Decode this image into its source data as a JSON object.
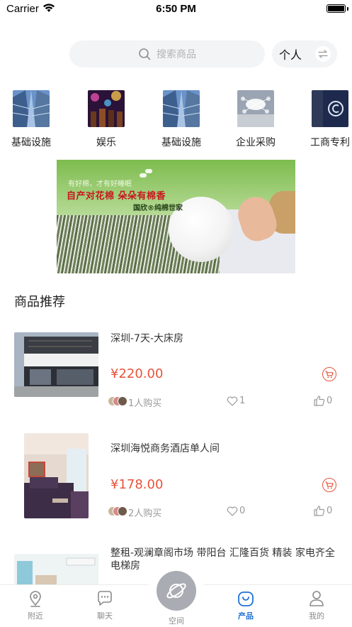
{
  "status_bar": {
    "carrier": "Carrier",
    "time": "6:50 PM"
  },
  "search": {
    "placeholder": "搜索商品"
  },
  "personal_switch": {
    "label": "个人"
  },
  "categories": [
    {
      "label": "基础设施",
      "icon": "skyscraper-thumbnail"
    },
    {
      "label": "娱乐",
      "icon": "concert-thumbnail"
    },
    {
      "label": "基础设施",
      "icon": "skyscraper-thumbnail"
    },
    {
      "label": "企业采购",
      "icon": "cloud-network-thumbnail"
    },
    {
      "label": "工商专利",
      "icon": "copyright-thumbnail"
    }
  ],
  "banner": {
    "tagline": "有好棉，才有好睡眠",
    "slogan": "自产对花棉 朵朵有棉香",
    "brand": "国欣®纯棉世家"
  },
  "section": {
    "title": "商品推荐"
  },
  "products": [
    {
      "title": "深圳-7天-大床房",
      "price": "¥220.00",
      "buyers": "1人购买",
      "likes": "1",
      "thumbs": "0"
    },
    {
      "title": "深圳海悦商务酒店单人间",
      "price": "¥178.00",
      "buyers": "2人购买",
      "likes": "0",
      "thumbs": "0"
    },
    {
      "title": "整租-观澜章阁市场 带阳台 汇隆百货 精装 家电齐全 电梯房"
    }
  ],
  "tabbar": {
    "items": [
      {
        "label": "附近",
        "icon": "location-pin-icon"
      },
      {
        "label": "聊天",
        "icon": "chat-bubble-icon"
      },
      {
        "label": "空间",
        "icon": "planet-icon"
      },
      {
        "label": "产品",
        "icon": "bag-icon",
        "active": true
      },
      {
        "label": "我的",
        "icon": "person-icon"
      }
    ]
  },
  "colors": {
    "accent": "#2170d6",
    "price": "#e8533b",
    "muted": "#999999"
  }
}
